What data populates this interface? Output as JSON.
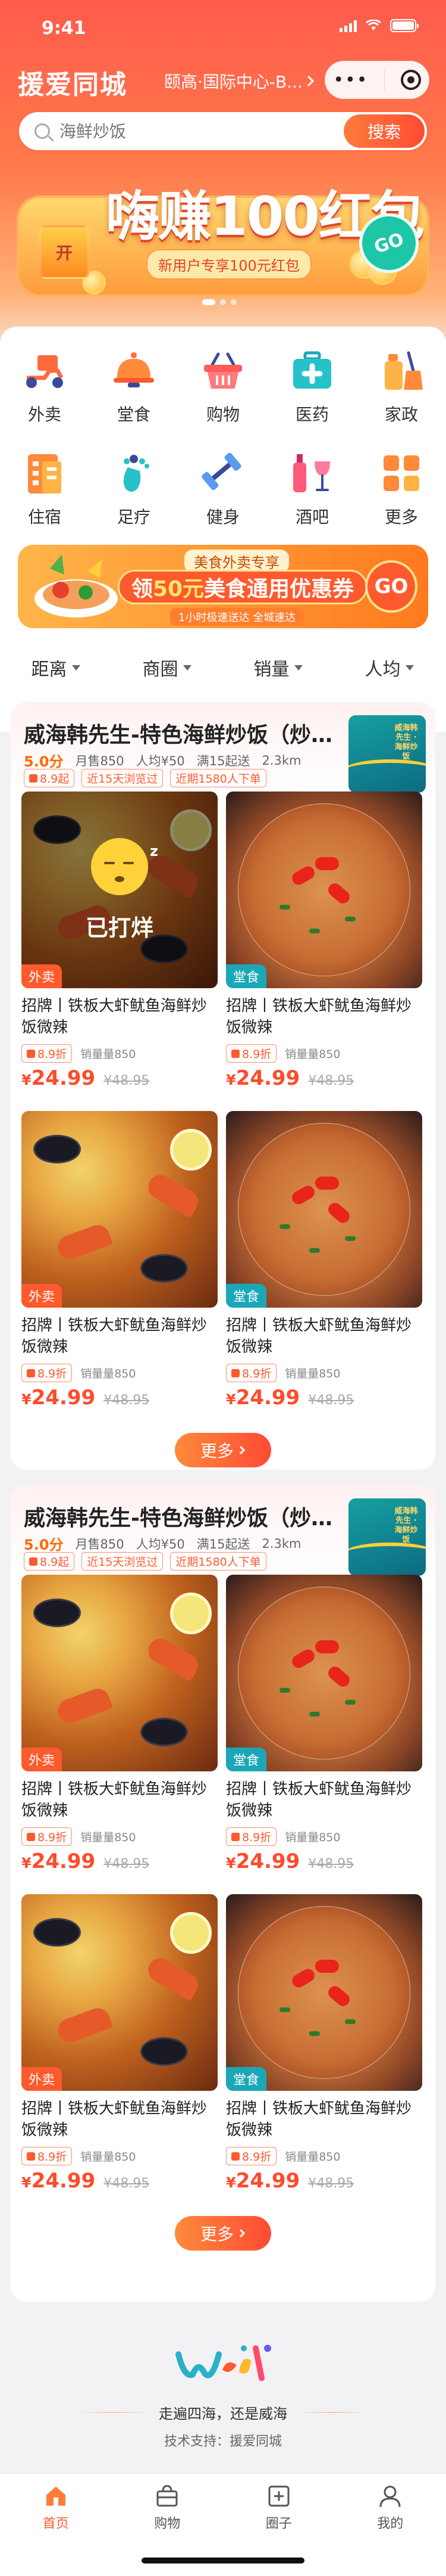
{
  "status_bar": {
    "time": "9:41"
  },
  "header": {
    "title": "援爱同城",
    "location": "颐高·国际中心-B..."
  },
  "search": {
    "placeholder": "海鲜炒饭",
    "button": "搜索"
  },
  "banner": {
    "title": "嗨赚100红包",
    "subtitle": "新用户专享100元红包",
    "gift_text": "开",
    "go": "GO"
  },
  "categories": [
    {
      "label": "外卖",
      "icon": "scooter-icon"
    },
    {
      "label": "堂食",
      "icon": "cloche-icon"
    },
    {
      "label": "购物",
      "icon": "basket-icon"
    },
    {
      "label": "医药",
      "icon": "medkit-icon"
    },
    {
      "label": "家政",
      "icon": "cleaning-icon"
    },
    {
      "label": "住宿",
      "icon": "hotel-icon"
    },
    {
      "label": "足疗",
      "icon": "foot-icon"
    },
    {
      "label": "健身",
      "icon": "dumbbell-icon"
    },
    {
      "label": "酒吧",
      "icon": "wine-icon"
    },
    {
      "label": "更多",
      "icon": "grid-icon"
    }
  ],
  "promo": {
    "tag": "美食外卖专享",
    "title_pre": "领",
    "amount": "50元",
    "title_post": "美食通用优惠券",
    "sub": "1小时极速送达 全城速达",
    "go": "GO"
  },
  "sort": {
    "distance": "距离",
    "mall": "商圈",
    "sales": "销量",
    "avg": "人均"
  },
  "shops": [
    {
      "name": "威海韩先生-特色海鲜炒饭（炒饭...",
      "score": "5.0分",
      "sold": "月售850",
      "avg": "人均¥50",
      "min": "满15起送",
      "distance": "2.3km",
      "discount": "8.9起",
      "visited": "近15天浏览过",
      "recent": "近期1580人下单",
      "logo_text": "威海韩先生 · 海鲜炒饭",
      "more": "更多",
      "items": [
        {
          "title": "招牌丨铁板大虾鱿鱼海鲜炒饭微辣",
          "badge": "外卖",
          "discount": "8.9折",
          "sales": "销量量850",
          "price": "24.99",
          "orig": "¥48.95",
          "closed": "已打烊",
          "img": "seafood"
        },
        {
          "title": "招牌丨铁板大虾鱿鱼海鲜炒饭微辣",
          "badge": "堂食",
          "discount": "8.9折",
          "sales": "销量量850",
          "price": "24.99",
          "orig": "¥48.95",
          "img": "risotto"
        },
        {
          "title": "招牌丨铁板大虾鱿鱼海鲜炒饭微辣",
          "badge": "外卖",
          "discount": "8.9折",
          "sales": "销量量850",
          "price": "24.99",
          "orig": "¥48.95",
          "img": "seafood"
        },
        {
          "title": "招牌丨铁板大虾鱿鱼海鲜炒饭微辣",
          "badge": "堂食",
          "discount": "8.9折",
          "sales": "销量量850",
          "price": "24.99",
          "orig": "¥48.95",
          "img": "risotto"
        }
      ]
    },
    {
      "name": "威海韩先生-特色海鲜炒饭（炒饭...",
      "score": "5.0分",
      "sold": "月售850",
      "avg": "人均¥50",
      "min": "满15起送",
      "distance": "2.3km",
      "discount": "8.9起",
      "visited": "近15天浏览过",
      "recent": "近期1580人下单",
      "logo_text": "威海韩先生 · 海鲜炒饭",
      "more": "更多",
      "items": [
        {
          "title": "招牌丨铁板大虾鱿鱼海鲜炒饭微辣",
          "badge": "外卖",
          "discount": "8.9折",
          "sales": "销量量850",
          "price": "24.99",
          "orig": "¥48.95",
          "img": "seafood"
        },
        {
          "title": "招牌丨铁板大虾鱿鱼海鲜炒饭微辣",
          "badge": "堂食",
          "discount": "8.9折",
          "sales": "销量量850",
          "price": "24.99",
          "orig": "¥48.95",
          "img": "risotto"
        },
        {
          "title": "招牌丨铁板大虾鱿鱼海鲜炒饭微辣",
          "badge": "外卖",
          "discount": "8.9折",
          "sales": "销量量850",
          "price": "24.99",
          "orig": "¥48.95",
          "img": "seafood"
        },
        {
          "title": "招牌丨铁板大虾鱿鱼海鲜炒饭微辣",
          "badge": "堂食",
          "discount": "8.9折",
          "sales": "销量量850",
          "price": "24.99",
          "orig": "¥48.95",
          "img": "risotto"
        }
      ]
    }
  ],
  "footer": {
    "logo_text": "weihai",
    "slogan": "走遍四海，还是威海",
    "support": "技术支持：援爱同城"
  },
  "tabbar": [
    {
      "label": "首页",
      "icon": "home-icon",
      "active": true
    },
    {
      "label": "购物",
      "icon": "bag-icon",
      "active": false
    },
    {
      "label": "圈子",
      "icon": "circle-post-icon",
      "active": false
    },
    {
      "label": "我的",
      "icon": "user-icon",
      "active": false
    }
  ],
  "colors": {
    "brand": "#ff5a2d",
    "teal": "#1ba7b8",
    "price": "#ff4b2b"
  }
}
